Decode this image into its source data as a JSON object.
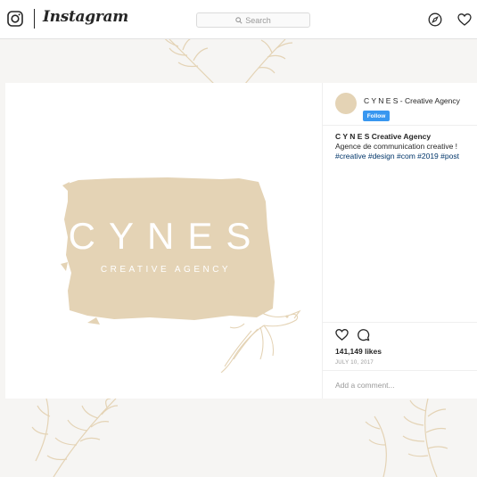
{
  "nav": {
    "brand": "Instagram",
    "search_placeholder": "Search",
    "icons": [
      "instagram-glyph-icon",
      "search-icon",
      "compass-icon",
      "heart-icon"
    ]
  },
  "post": {
    "image": {
      "logo_title": "CYNES",
      "logo_subtitle": "CREATIVE AGENCY"
    },
    "header": {
      "username": "C Y N E S - Creative Agency",
      "follow_label": "Follow"
    },
    "caption": {
      "username": "C Y N E S  Creative Agency",
      "text": "Agence de communication creative !",
      "hashtags": "#creative #design #com #2019 #post"
    },
    "likes": "141,149 likes",
    "date": "JULY 10, 2017",
    "add_comment_placeholder": "Add a comment..."
  },
  "colors": {
    "accent_beige": "#e4d3b5",
    "follow_blue": "#3897f0",
    "hashtag_blue": "#003569"
  }
}
